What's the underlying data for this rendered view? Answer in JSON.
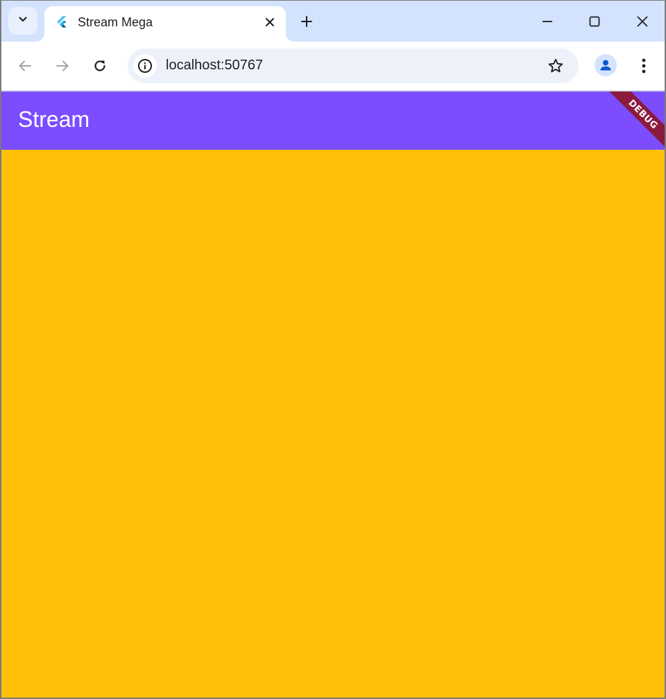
{
  "browser": {
    "tab": {
      "title": "Stream Mega"
    },
    "address_bar": {
      "url": "localhost:50767"
    }
  },
  "icons": {
    "tab_search": "chevron-down-icon",
    "tab_favicon": "flutter-icon",
    "tab_close": "close-icon",
    "new_tab": "plus-icon",
    "minimize": "minimize-icon",
    "maximize": "maximize-icon",
    "close_window": "close-icon",
    "back": "arrow-left-icon",
    "forward": "arrow-right-icon",
    "reload": "reload-icon",
    "site_info": "info-icon",
    "bookmark": "star-icon",
    "profile": "person-icon",
    "menu": "more-vert-icon"
  },
  "app": {
    "appbar": {
      "title": "Stream"
    },
    "debug_banner": "DEBUG"
  },
  "colors": {
    "appbar": "#7c4dff",
    "body": "#ffc107",
    "debug_banner": "#8b1a3e",
    "tabstrip": "#d3e3fd"
  }
}
